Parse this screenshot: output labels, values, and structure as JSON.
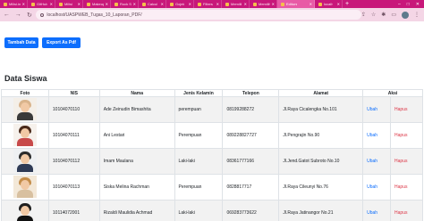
{
  "browser": {
    "tabs": [
      {
        "label": "Milisi.in",
        "active": false
      },
      {
        "label": "GitHub",
        "active": false
      },
      {
        "label": "Milisi",
        "active": false
      },
      {
        "label": "Makeup",
        "active": false
      },
      {
        "label": "Rock St",
        "active": false
      },
      {
        "label": "Calcul",
        "active": false
      },
      {
        "label": "Gojek",
        "active": false
      },
      {
        "label": "Filters",
        "active": false
      },
      {
        "label": "Memilli",
        "active": false
      },
      {
        "label": "Memilih",
        "active": false
      },
      {
        "label": "Editors",
        "active": true
      },
      {
        "label": "localh",
        "active": false
      }
    ],
    "url": "localhost/UASPWEB_Tugas_10_Laporan_PDF/"
  },
  "toolbar": {
    "add_label": "Tambah Data",
    "pdf_label": "Export As Pdf"
  },
  "page": {
    "title": "Data Siswa"
  },
  "table": {
    "headers": [
      "Foto",
      "NIS",
      "Nama",
      "Jenis Kelamin",
      "Telepon",
      "Alamat",
      "Aksi"
    ],
    "edit_label": "Ubah",
    "delete_label": "Hapus",
    "rows": [
      {
        "nis": "10104070110",
        "nama": "Ade Zeinudin Bimashita",
        "jk": "perempuan",
        "telepon": "08199288272",
        "alamat": "Jl.Raya Cicalengka No.101"
      },
      {
        "nis": "10104070111",
        "nama": "Ani Lestari",
        "jk": "Perempuan",
        "telepon": "089228827727",
        "alamat": "Jl.Pengrajin No.90"
      },
      {
        "nis": "10104070112",
        "nama": "Imam Maulana",
        "jk": "Laki-laki",
        "telepon": "08361777166",
        "alamat": "Jl.Jend.Gatot Subroto No.10"
      },
      {
        "nis": "10104070113",
        "nama": "Siska Melina Rachman",
        "jk": "Perempuan",
        "telepon": "0828817717",
        "alamat": "Jl.Raya Cileunyi No.76"
      },
      {
        "nis": "10114072001",
        "nama": "Rizaldi Maulidia Achmad",
        "jk": "Laki-laki",
        "telepon": "069283773622",
        "alamat": "Jl.Raya Jatinangor No.21"
      }
    ]
  }
}
